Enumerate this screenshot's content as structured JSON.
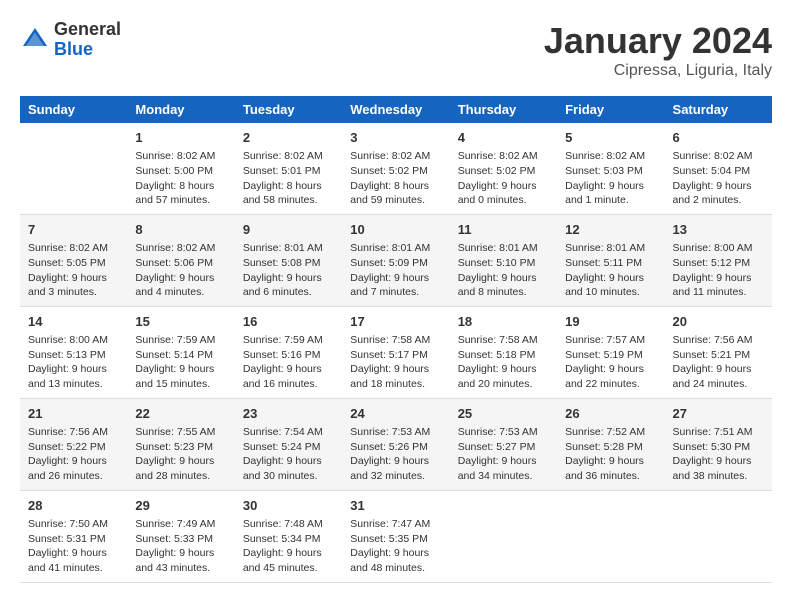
{
  "header": {
    "logo_line1": "General",
    "logo_line2": "Blue",
    "main_title": "January 2024",
    "subtitle": "Cipressa, Liguria, Italy"
  },
  "days_of_week": [
    "Sunday",
    "Monday",
    "Tuesday",
    "Wednesday",
    "Thursday",
    "Friday",
    "Saturday"
  ],
  "weeks": [
    [
      {
        "day": "",
        "info": ""
      },
      {
        "day": "1",
        "info": "Sunrise: 8:02 AM\nSunset: 5:00 PM\nDaylight: 8 hours\nand 57 minutes."
      },
      {
        "day": "2",
        "info": "Sunrise: 8:02 AM\nSunset: 5:01 PM\nDaylight: 8 hours\nand 58 minutes."
      },
      {
        "day": "3",
        "info": "Sunrise: 8:02 AM\nSunset: 5:02 PM\nDaylight: 8 hours\nand 59 minutes."
      },
      {
        "day": "4",
        "info": "Sunrise: 8:02 AM\nSunset: 5:02 PM\nDaylight: 9 hours\nand 0 minutes."
      },
      {
        "day": "5",
        "info": "Sunrise: 8:02 AM\nSunset: 5:03 PM\nDaylight: 9 hours\nand 1 minute."
      },
      {
        "day": "6",
        "info": "Sunrise: 8:02 AM\nSunset: 5:04 PM\nDaylight: 9 hours\nand 2 minutes."
      }
    ],
    [
      {
        "day": "7",
        "info": "Sunrise: 8:02 AM\nSunset: 5:05 PM\nDaylight: 9 hours\nand 3 minutes."
      },
      {
        "day": "8",
        "info": "Sunrise: 8:02 AM\nSunset: 5:06 PM\nDaylight: 9 hours\nand 4 minutes."
      },
      {
        "day": "9",
        "info": "Sunrise: 8:01 AM\nSunset: 5:08 PM\nDaylight: 9 hours\nand 6 minutes."
      },
      {
        "day": "10",
        "info": "Sunrise: 8:01 AM\nSunset: 5:09 PM\nDaylight: 9 hours\nand 7 minutes."
      },
      {
        "day": "11",
        "info": "Sunrise: 8:01 AM\nSunset: 5:10 PM\nDaylight: 9 hours\nand 8 minutes."
      },
      {
        "day": "12",
        "info": "Sunrise: 8:01 AM\nSunset: 5:11 PM\nDaylight: 9 hours\nand 10 minutes."
      },
      {
        "day": "13",
        "info": "Sunrise: 8:00 AM\nSunset: 5:12 PM\nDaylight: 9 hours\nand 11 minutes."
      }
    ],
    [
      {
        "day": "14",
        "info": "Sunrise: 8:00 AM\nSunset: 5:13 PM\nDaylight: 9 hours\nand 13 minutes."
      },
      {
        "day": "15",
        "info": "Sunrise: 7:59 AM\nSunset: 5:14 PM\nDaylight: 9 hours\nand 15 minutes."
      },
      {
        "day": "16",
        "info": "Sunrise: 7:59 AM\nSunset: 5:16 PM\nDaylight: 9 hours\nand 16 minutes."
      },
      {
        "day": "17",
        "info": "Sunrise: 7:58 AM\nSunset: 5:17 PM\nDaylight: 9 hours\nand 18 minutes."
      },
      {
        "day": "18",
        "info": "Sunrise: 7:58 AM\nSunset: 5:18 PM\nDaylight: 9 hours\nand 20 minutes."
      },
      {
        "day": "19",
        "info": "Sunrise: 7:57 AM\nSunset: 5:19 PM\nDaylight: 9 hours\nand 22 minutes."
      },
      {
        "day": "20",
        "info": "Sunrise: 7:56 AM\nSunset: 5:21 PM\nDaylight: 9 hours\nand 24 minutes."
      }
    ],
    [
      {
        "day": "21",
        "info": "Sunrise: 7:56 AM\nSunset: 5:22 PM\nDaylight: 9 hours\nand 26 minutes."
      },
      {
        "day": "22",
        "info": "Sunrise: 7:55 AM\nSunset: 5:23 PM\nDaylight: 9 hours\nand 28 minutes."
      },
      {
        "day": "23",
        "info": "Sunrise: 7:54 AM\nSunset: 5:24 PM\nDaylight: 9 hours\nand 30 minutes."
      },
      {
        "day": "24",
        "info": "Sunrise: 7:53 AM\nSunset: 5:26 PM\nDaylight: 9 hours\nand 32 minutes."
      },
      {
        "day": "25",
        "info": "Sunrise: 7:53 AM\nSunset: 5:27 PM\nDaylight: 9 hours\nand 34 minutes."
      },
      {
        "day": "26",
        "info": "Sunrise: 7:52 AM\nSunset: 5:28 PM\nDaylight: 9 hours\nand 36 minutes."
      },
      {
        "day": "27",
        "info": "Sunrise: 7:51 AM\nSunset: 5:30 PM\nDaylight: 9 hours\nand 38 minutes."
      }
    ],
    [
      {
        "day": "28",
        "info": "Sunrise: 7:50 AM\nSunset: 5:31 PM\nDaylight: 9 hours\nand 41 minutes."
      },
      {
        "day": "29",
        "info": "Sunrise: 7:49 AM\nSunset: 5:33 PM\nDaylight: 9 hours\nand 43 minutes."
      },
      {
        "day": "30",
        "info": "Sunrise: 7:48 AM\nSunset: 5:34 PM\nDaylight: 9 hours\nand 45 minutes."
      },
      {
        "day": "31",
        "info": "Sunrise: 7:47 AM\nSunset: 5:35 PM\nDaylight: 9 hours\nand 48 minutes."
      },
      {
        "day": "",
        "info": ""
      },
      {
        "day": "",
        "info": ""
      },
      {
        "day": "",
        "info": ""
      }
    ]
  ]
}
